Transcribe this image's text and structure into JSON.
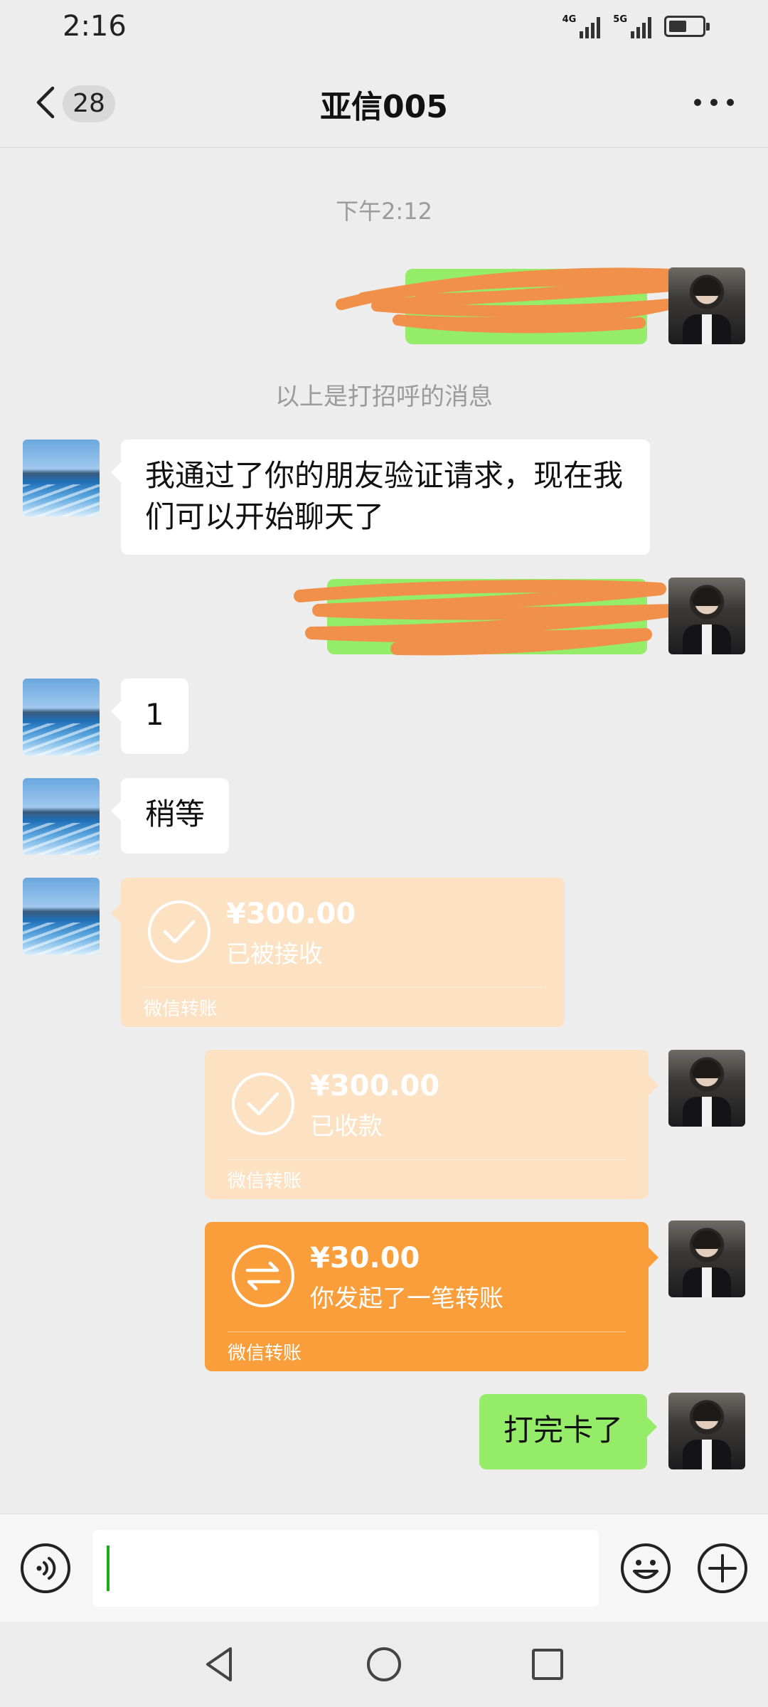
{
  "status_bar": {
    "time": "2:16",
    "network_1": "4G",
    "network_2": "5G",
    "battery_icon": "battery-icon"
  },
  "header": {
    "back_icon": "chevron-left-icon",
    "unread_count": "28",
    "title": "亚信005",
    "more_icon": "more-dots-icon"
  },
  "chat": {
    "timestamp": "下午2:12",
    "system_notice": "以上是打招呼的消息",
    "messages": [
      {
        "id": "m1",
        "sender": "self",
        "type": "text",
        "text": "",
        "redacted": true
      },
      {
        "id": "m2",
        "sender": "other",
        "type": "text",
        "text": "我通过了你的朋友验证请求，现在我们可以开始聊天了"
      },
      {
        "id": "m3",
        "sender": "self",
        "type": "text",
        "text": "",
        "redacted": true
      },
      {
        "id": "m4",
        "sender": "other",
        "type": "text",
        "text": "1"
      },
      {
        "id": "m5",
        "sender": "other",
        "type": "text",
        "text": "稍等"
      },
      {
        "id": "m6",
        "sender": "other",
        "type": "transfer",
        "amount": "¥300.00",
        "status": "已被接收",
        "footer": "微信转账",
        "icon": "check-circle-icon"
      },
      {
        "id": "m7",
        "sender": "self",
        "type": "transfer",
        "amount": "¥300.00",
        "status": "已收款",
        "footer": "微信转账",
        "icon": "check-circle-icon"
      },
      {
        "id": "m8",
        "sender": "self",
        "type": "transfer",
        "amount": "¥30.00",
        "status": "你发起了一笔转账",
        "footer": "微信转账",
        "icon": "transfer-arrows-icon"
      },
      {
        "id": "m9",
        "sender": "self",
        "type": "text",
        "text": "打完卡了"
      }
    ]
  },
  "input_bar": {
    "voice_icon": "voice-icon",
    "input_value": "",
    "emoji_icon": "emoji-icon",
    "plus_icon": "plus-icon"
  },
  "nav_bar": {
    "back_icon": "nav-back-icon",
    "home_icon": "nav-home-icon",
    "recents_icon": "nav-recents-icon"
  },
  "colors": {
    "background": "#ededed",
    "bubble_self": "#95ec69",
    "bubble_other": "#ffffff",
    "transfer_accepted": "#fce1c3",
    "transfer_pending": "#fa9e3b",
    "redaction": "#f0904a",
    "caret": "#1aad19"
  }
}
